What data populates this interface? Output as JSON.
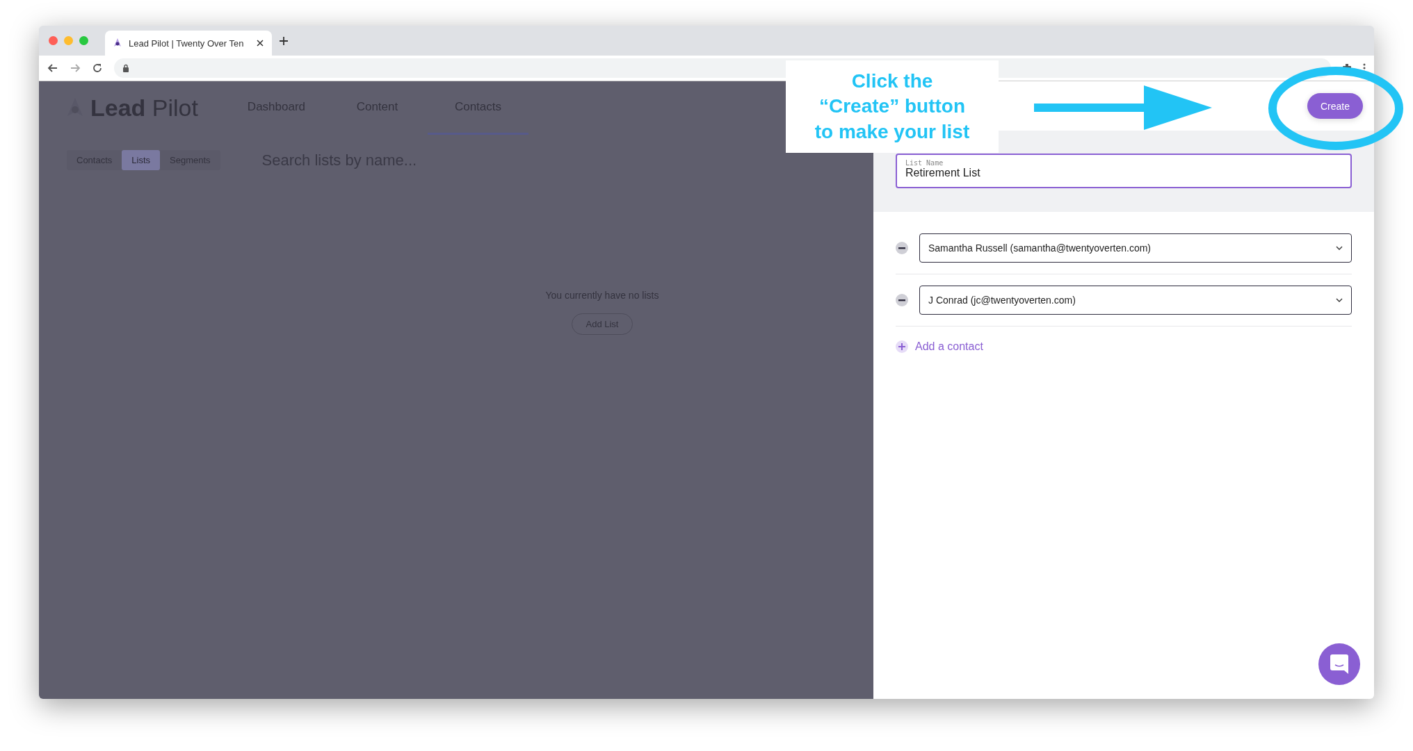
{
  "browser": {
    "tab_title": "Lead Pilot | Twenty Over Ten"
  },
  "app": {
    "logo": {
      "bold": "Lead",
      "light": "Pilot"
    },
    "nav": [
      {
        "label": "Dashboard",
        "selected": false
      },
      {
        "label": "Content",
        "selected": false
      },
      {
        "label": "Contacts",
        "selected": true
      }
    ],
    "subtabs": [
      {
        "label": "Contacts",
        "selected": false
      },
      {
        "label": "Lists",
        "selected": true
      },
      {
        "label": "Segments",
        "selected": false
      }
    ],
    "search": {
      "placeholder": "Search lists by name..."
    },
    "empty_message": "You currently have no lists",
    "add_button": "Add List"
  },
  "panel": {
    "create_button": "Create",
    "list_name": {
      "label": "List Name",
      "value": "Retirement List"
    },
    "contacts": [
      {
        "value": "Samantha Russell (samantha@twentyoverten.com)"
      },
      {
        "value": "J Conrad (jc@twentyoverten.com)"
      }
    ],
    "add_contact": "Add a contact"
  },
  "callout": {
    "text": "Click the “Create” button to make your list"
  }
}
